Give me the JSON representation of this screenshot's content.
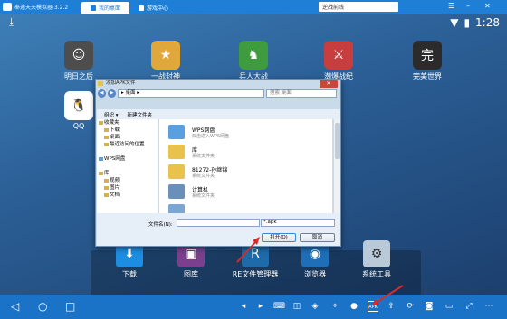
{
  "window": {
    "title": "奉途天天模拟器 3.2.2",
    "tabs": [
      {
        "label": "我的桌面",
        "active": true
      },
      {
        "label": "游戏中心",
        "active": false
      }
    ],
    "search_value": "逆战前线",
    "controls": [
      "☰",
      "–",
      "✕"
    ]
  },
  "statusbar": {
    "time": "1:28"
  },
  "apps": [
    {
      "label": "明日之后",
      "color": "#4d4d4d",
      "glyph": "☺"
    },
    {
      "label": "一战封神",
      "color": "#e0a83a",
      "glyph": "★"
    },
    {
      "label": "兵人大战",
      "color": "#3e9b3e",
      "glyph": "♞"
    },
    {
      "label": "潮爆战纪",
      "color": "#c83e3e",
      "glyph": "⚔"
    },
    {
      "label": "完美世界",
      "color": "#2b2b2b",
      "glyph": "完"
    },
    {
      "label": "QQ",
      "color": "#ffffff",
      "glyph": "🐧"
    }
  ],
  "dock": [
    {
      "label": "下载",
      "color": "#1c8de0",
      "glyph": "⬇"
    },
    {
      "label": "图库",
      "color": "#7a3f8e",
      "glyph": "▣"
    },
    {
      "label": "RE文件管理器",
      "color": "#1f6aa8",
      "glyph": "R"
    },
    {
      "label": "浏览器",
      "color": "#1e6fb8",
      "glyph": "◉"
    },
    {
      "label": "系统工具",
      "color": "#b9c9d8",
      "glyph": "⚙"
    }
  ],
  "dialog": {
    "title": "添加APK文件",
    "close": "✕",
    "address": "▸ 桌面 ▸",
    "search_placeholder": "搜索 桌面",
    "toolbar": [
      "组织 ▾",
      "新建文件夹"
    ],
    "nav": [
      {
        "label": "收藏夹",
        "sub": false
      },
      {
        "label": "下载",
        "sub": true
      },
      {
        "label": "桌面",
        "sub": true
      },
      {
        "label": "最近访问的位置",
        "sub": true
      },
      {
        "label": "",
        "sub": false
      },
      {
        "label": "WPS网盘",
        "sub": false
      },
      {
        "label": "",
        "sub": false
      },
      {
        "label": "库",
        "sub": false
      },
      {
        "label": "视频",
        "sub": true
      },
      {
        "label": "图片",
        "sub": true
      },
      {
        "label": "文档",
        "sub": true
      }
    ],
    "files": [
      {
        "name": "WPS网盘",
        "desc": "双击进入WPS网盘",
        "color": "#5aa0e0"
      },
      {
        "name": "库",
        "desc": "系统文件夹",
        "color": "#e8c24a"
      },
      {
        "name": "81272-孙继锦",
        "desc": "系统文件夹",
        "color": "#e8c24a"
      },
      {
        "name": "计算机",
        "desc": "系统文件夹",
        "color": "#6a8fb8"
      },
      {
        "name": "",
        "desc": "",
        "color": "#7aa6d6"
      }
    ],
    "filename_label": "文件名(N):",
    "filename_value": "",
    "filetype_value": "*.apk",
    "open_label": "打开(O)",
    "cancel_label": "取消"
  },
  "bottombar": {
    "nav": [
      "◁",
      "○",
      "□"
    ]
  }
}
